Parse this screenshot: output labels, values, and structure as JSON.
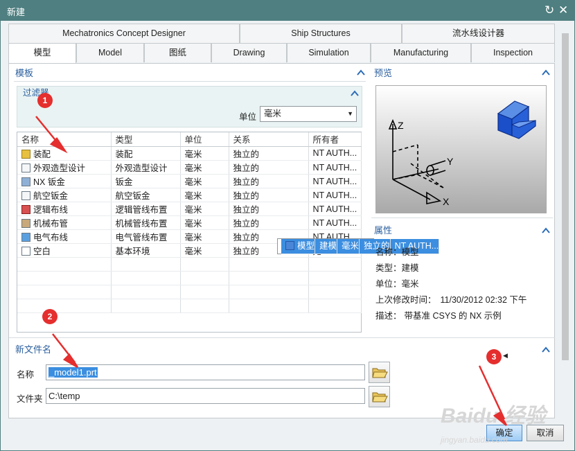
{
  "window": {
    "title": "新建"
  },
  "tabs_row1": [
    {
      "label": "Mechatronics Concept Designer"
    },
    {
      "label": "Ship Structures"
    },
    {
      "label": "流水线设计器"
    }
  ],
  "tabs_row2": [
    {
      "label": "模型"
    },
    {
      "label": "Model"
    },
    {
      "label": "图纸"
    },
    {
      "label": "Drawing"
    },
    {
      "label": "Simulation"
    },
    {
      "label": "Manufacturing"
    },
    {
      "label": "Inspection"
    }
  ],
  "template_section": {
    "title": "模板"
  },
  "filter": {
    "title": "过滤器",
    "unit_label": "单位",
    "unit_value": "毫米"
  },
  "table": {
    "headers": [
      "名称",
      "类型",
      "单位",
      "关系",
      "所有者"
    ],
    "rows": [
      {
        "name": "模型",
        "type": "建模",
        "unit": "毫米",
        "relation": "独立的",
        "owner": "NT AUTH...",
        "icon": "model-icon",
        "selected": true
      },
      {
        "name": "装配",
        "type": "装配",
        "unit": "毫米",
        "relation": "独立的",
        "owner": "NT AUTH...",
        "icon": "assembly-icon"
      },
      {
        "name": "外观造型设计",
        "type": "外观造型设计",
        "unit": "毫米",
        "relation": "独立的",
        "owner": "NT AUTH...",
        "icon": "shape-studio-icon"
      },
      {
        "name": "NX 钣金",
        "type": "钣金",
        "unit": "毫米",
        "relation": "独立的",
        "owner": "NT AUTH...",
        "icon": "sheet-metal-icon"
      },
      {
        "name": "航空钣金",
        "type": "航空钣金",
        "unit": "毫米",
        "relation": "独立的",
        "owner": "NT AUTH...",
        "icon": "aero-sheet-metal-icon"
      },
      {
        "name": "逻辑布线",
        "type": "逻辑管线布置",
        "unit": "毫米",
        "relation": "独立的",
        "owner": "NT AUTH...",
        "icon": "logical-routing-icon"
      },
      {
        "name": "机械布管",
        "type": "机械管线布置",
        "unit": "毫米",
        "relation": "独立的",
        "owner": "NT AUTH...",
        "icon": "mechanical-routing-icon"
      },
      {
        "name": "电气布线",
        "type": "电气管线布置",
        "unit": "毫米",
        "relation": "独立的",
        "owner": "NT AUTH...",
        "icon": "electrical-routing-icon"
      },
      {
        "name": "空白",
        "type": "基本环境",
        "unit": "毫米",
        "relation": "独立的",
        "owner": "无",
        "icon": "blank-icon"
      }
    ]
  },
  "preview_section": {
    "title": "预览",
    "axis_z": "Z",
    "axis_y": "Y",
    "axis_x": "X"
  },
  "properties_section": {
    "title": "属性",
    "rows": [
      {
        "label": "名称：",
        "value": "模型"
      },
      {
        "label": "类型：",
        "value": "建模"
      },
      {
        "label": "单位：",
        "value": "毫米"
      },
      {
        "label": "上次修改时间：",
        "value": "11/30/2012 02:32 下午"
      },
      {
        "label": "描述：",
        "value": "带基准 CSYS 的 NX 示例"
      }
    ]
  },
  "new_file_section": {
    "title": "新文件名",
    "name_label": "名称",
    "name_value": "_model1.prt",
    "folder_label": "文件夹",
    "folder_value": "C:\\temp"
  },
  "buttons": {
    "ok": "确定",
    "cancel": "取消"
  },
  "annotations": [
    "1",
    "2",
    "3"
  ],
  "watermark": {
    "brand": "Baidu 经验",
    "url": "jingyan.baidu.com"
  },
  "colors": {
    "titlebar": "#4f7f80",
    "accent": "#2b5f9e",
    "selection": "#3b8ee0",
    "badge": "#e52e2e"
  }
}
